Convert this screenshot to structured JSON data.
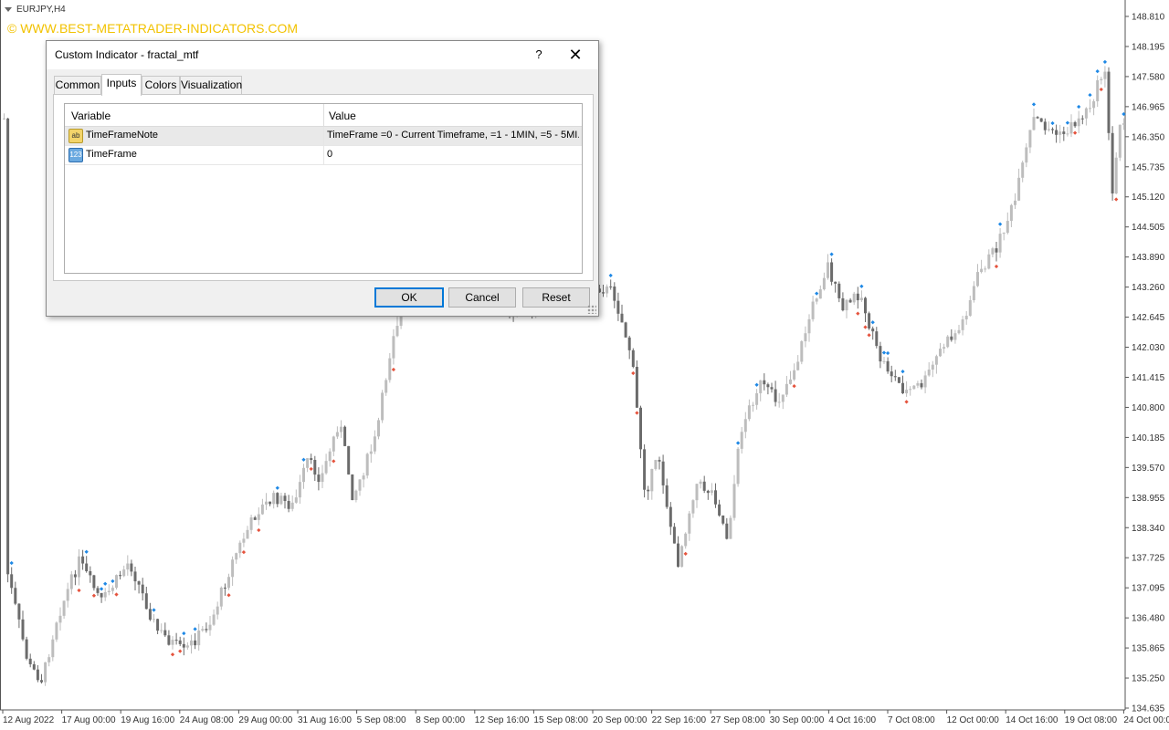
{
  "chart": {
    "symbol": "EURJPY,H4",
    "watermark": "© WWW.BEST-METATRADER-INDICATORS.COM",
    "price_labels": [
      "148.810",
      "148.195",
      "147.580",
      "146.965",
      "146.350",
      "145.735",
      "145.120",
      "144.505",
      "143.890",
      "143.260",
      "142.645",
      "142.030",
      "141.415",
      "140.800",
      "140.185",
      "139.570",
      "138.955",
      "138.340",
      "137.725",
      "137.095",
      "136.480",
      "135.865",
      "135.250",
      "134.635"
    ],
    "time_labels": [
      "12 Aug 2022",
      "17 Aug 00:00",
      "19 Aug 16:00",
      "24 Aug 08:00",
      "29 Aug 00:00",
      "31 Aug 16:00",
      "5 Sep 08:00",
      "8 Sep 00:00",
      "12 Sep 16:00",
      "15 Sep 08:00",
      "20 Sep 00:00",
      "22 Sep 16:00",
      "27 Sep 08:00",
      "30 Sep 00:00",
      "4 Oct 16:00",
      "7 Oct 08:00",
      "12 Oct 00:00",
      "14 Oct 16:00",
      "19 Oct 08:00",
      "24 Oct 00:00"
    ],
    "colors": {
      "bull": "#bdbdbd",
      "bear": "#6b6b6b",
      "fractal_up": "#1e88e5",
      "fractal_down": "#e5533d",
      "axis": "#333333",
      "watermark": "#f2c200"
    }
  },
  "dialog": {
    "title": "Custom Indicator - fractal_mtf",
    "help_label": "?",
    "close_label": "✕",
    "tabs": [
      "Common",
      "Inputs",
      "Colors",
      "Visualization"
    ],
    "active_tab": "Inputs",
    "columns": {
      "variable": "Variable",
      "value": "Value"
    },
    "rows": [
      {
        "icon": "ab",
        "variable": "TimeFrameNote",
        "value": "TimeFrame =0 - Current Timeframe, =1 - 1MIN, =5 - 5MI..."
      },
      {
        "icon": "123",
        "variable": "TimeFrame",
        "value": "0"
      }
    ],
    "buttons": {
      "ok": "OK",
      "cancel": "Cancel",
      "reset": "Reset"
    }
  }
}
